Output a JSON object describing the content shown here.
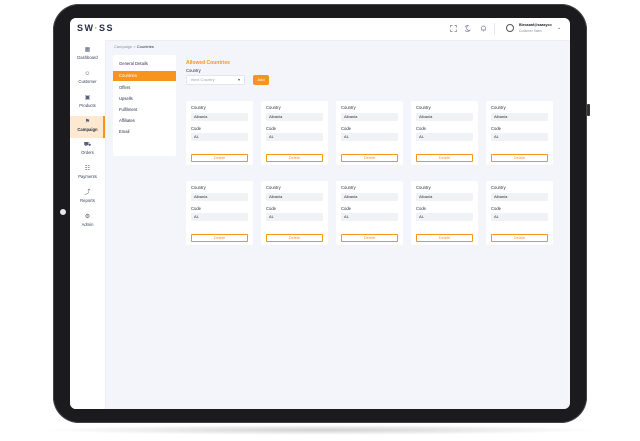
{
  "app": {
    "logo_main": "SW",
    "logo_accent": "·",
    "logo_end": "SS"
  },
  "header": {
    "user_name": "Bleosaaf@saasyco",
    "user_role": "Customer Sales",
    "icons": [
      "fullscreen-icon",
      "moon-icon",
      "bell-icon"
    ]
  },
  "sidebar": {
    "items": [
      {
        "label": "Dashboard",
        "icon": "▦"
      },
      {
        "label": "Customer",
        "icon": "☺"
      },
      {
        "label": "Products",
        "icon": "▣"
      },
      {
        "label": "Campaign",
        "icon": "⚑"
      },
      {
        "label": "Orders",
        "icon": "⛟"
      },
      {
        "label": "Payments",
        "icon": "☷"
      },
      {
        "label": "Reports",
        "icon": "⤴"
      },
      {
        "label": "Admin",
        "icon": "⚙"
      }
    ],
    "active_index": 3
  },
  "breadcrumb": {
    "parent": "Campaign",
    "separator": " > ",
    "current": "Countries"
  },
  "subnav": {
    "items": [
      "General Details",
      "Countries",
      "Offers",
      "Upsells",
      "Fulfilment",
      "Affiliates",
      "Email"
    ],
    "active_index": 1
  },
  "form": {
    "section_title": "Allowed Countries",
    "country_label": "Country",
    "select_placeholder": "elect Country",
    "add_label": "Add"
  },
  "cards": [
    {
      "country_label": "Country",
      "country": "Albania",
      "code_label": "Code",
      "code": "AL",
      "delete_label": "Delete"
    },
    {
      "country_label": "Country",
      "country": "Albania",
      "code_label": "Code",
      "code": "AL",
      "delete_label": "Delete"
    },
    {
      "country_label": "Country",
      "country": "Albania",
      "code_label": "Code",
      "code": "AL",
      "delete_label": "Delete"
    },
    {
      "country_label": "Country",
      "country": "Albania",
      "code_label": "Code",
      "code": "AL",
      "delete_label": "Delete"
    },
    {
      "country_label": "Country",
      "country": "Albania",
      "code_label": "Code",
      "code": "AL",
      "delete_label": "Delete"
    },
    {
      "country_label": "Country",
      "country": "Albania",
      "code_label": "Code",
      "code": "AL",
      "delete_label": "Delete"
    },
    {
      "country_label": "Country",
      "country": "Albania",
      "code_label": "Code",
      "code": "AL",
      "delete_label": "Delete"
    },
    {
      "country_label": "Country",
      "country": "Albania",
      "code_label": "Code",
      "code": "AL",
      "delete_label": "Delete"
    },
    {
      "country_label": "Country",
      "country": "Albania",
      "code_label": "Code",
      "code": "AL",
      "delete_label": "Delete"
    },
    {
      "country_label": "Country",
      "country": "Albania",
      "code_label": "Code",
      "code": "AL",
      "delete_label": "Delete"
    }
  ],
  "colors": {
    "accent": "#f7941d",
    "brand_dark": "#1f2a44",
    "bg": "#f3f5fb"
  }
}
